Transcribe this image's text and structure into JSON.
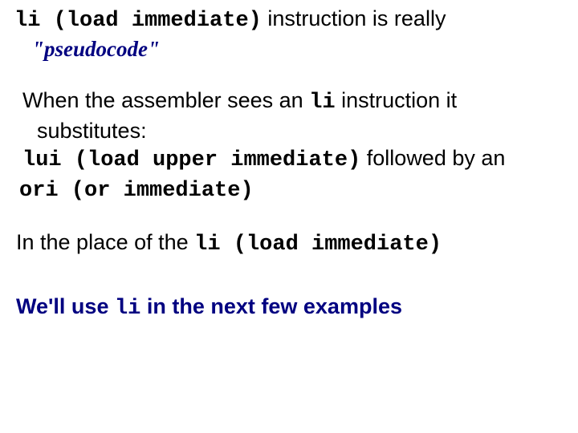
{
  "p1": {
    "code1": "li (load immediate)",
    "rest1": " instruction is really",
    "line2": "\"pseudocode\""
  },
  "p2": {
    "a": "When the assembler sees an ",
    "code": "li",
    "b": " instruction it substitutes:"
  },
  "p3": {
    "code": "lui (load upper immediate)",
    "rest": " followed by an"
  },
  "p4": {
    "code": "ori (or immediate)"
  },
  "p5": {
    "a": "In the place of the ",
    "code": "li (load immediate)"
  },
  "p6": {
    "a": "We'll use ",
    "code": "li",
    "b": " in the next few examples"
  }
}
